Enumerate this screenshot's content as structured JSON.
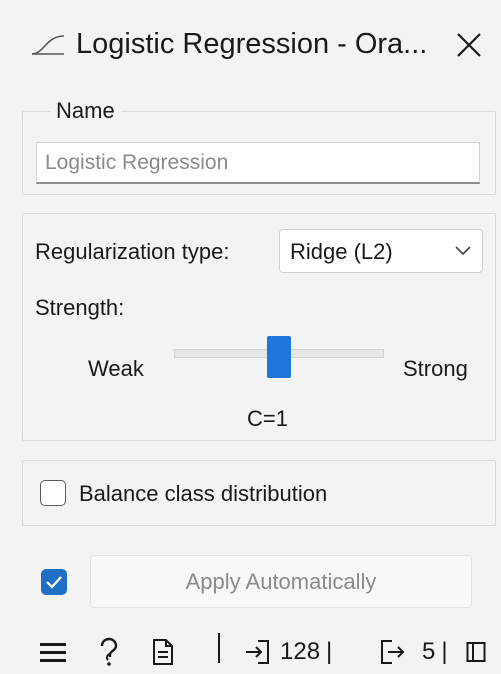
{
  "window": {
    "title": "Logistic Regression - Ora...",
    "close_glyph": "✕"
  },
  "name_box": {
    "title": "Name",
    "placeholder": "Logistic Regression",
    "value": ""
  },
  "regularization": {
    "type_label": "Regularization type:",
    "type_value": "Ridge (L2)",
    "strength_label": "Strength:",
    "weak_label": "Weak",
    "strong_label": "Strong",
    "c_value_label": "C=1",
    "slider_fraction": 0.5
  },
  "balance": {
    "label": "Balance class distribution",
    "checked": false
  },
  "apply": {
    "auto_checked": true,
    "label": "Apply Automatically"
  },
  "status_bar": {
    "input_count": "128",
    "input_sep": "|",
    "output_count": "5",
    "output_sep": "|"
  },
  "colors": {
    "accent": "#1f77d9",
    "checkbox_checked": "#1f6fc5",
    "background": "#f3f3f3"
  }
}
